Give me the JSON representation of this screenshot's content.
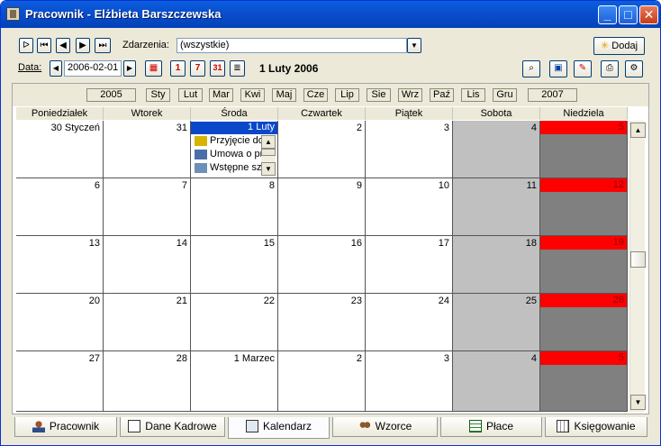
{
  "window": {
    "title": "Pracownik - Elżbieta Barszczewska"
  },
  "toolbar": {
    "events_label": "Zdarzenia:",
    "events_value": "(wszystkie)",
    "add_label": "Dodaj",
    "date_label": "Data:",
    "date_value": "2006-02-01",
    "date_display": "1 Luty 2006"
  },
  "months": {
    "prev_year": "2005",
    "next_year": "2007",
    "items": [
      "Sty",
      "Lut",
      "Mar",
      "Kwi",
      "Maj",
      "Cze",
      "Lip",
      "Sie",
      "Wrz",
      "Paź",
      "Lis",
      "Gru"
    ]
  },
  "weekdays": [
    "Poniedziałek",
    "Wtorek",
    "Środa",
    "Czwartek",
    "Piątek",
    "Sobota",
    "Niedziela"
  ],
  "weeks": [
    [
      "30 Styczeń",
      "31",
      "1 Luty",
      "2",
      "3",
      "4",
      "5"
    ],
    [
      "6",
      "7",
      "8",
      "9",
      "10",
      "11",
      "12"
    ],
    [
      "13",
      "14",
      "15",
      "16",
      "17",
      "18",
      "19"
    ],
    [
      "20",
      "21",
      "22",
      "23",
      "24",
      "25",
      "26"
    ],
    [
      "27",
      "28",
      "1 Marzec",
      "2",
      "3",
      "4",
      "5"
    ]
  ],
  "events": [
    "Przyjęcie do",
    "Umowa o pr",
    "Wstępne sz"
  ],
  "tabs": [
    "Pracownik",
    "Dane Kadrowe",
    "Kalendarz",
    "Wzorce",
    "Płace",
    "Księgowanie"
  ],
  "colors": {
    "saturday": "#c0c0c0",
    "sunday": "#808080",
    "sunday_header": "#ff0000",
    "today": "#0a47c9"
  }
}
